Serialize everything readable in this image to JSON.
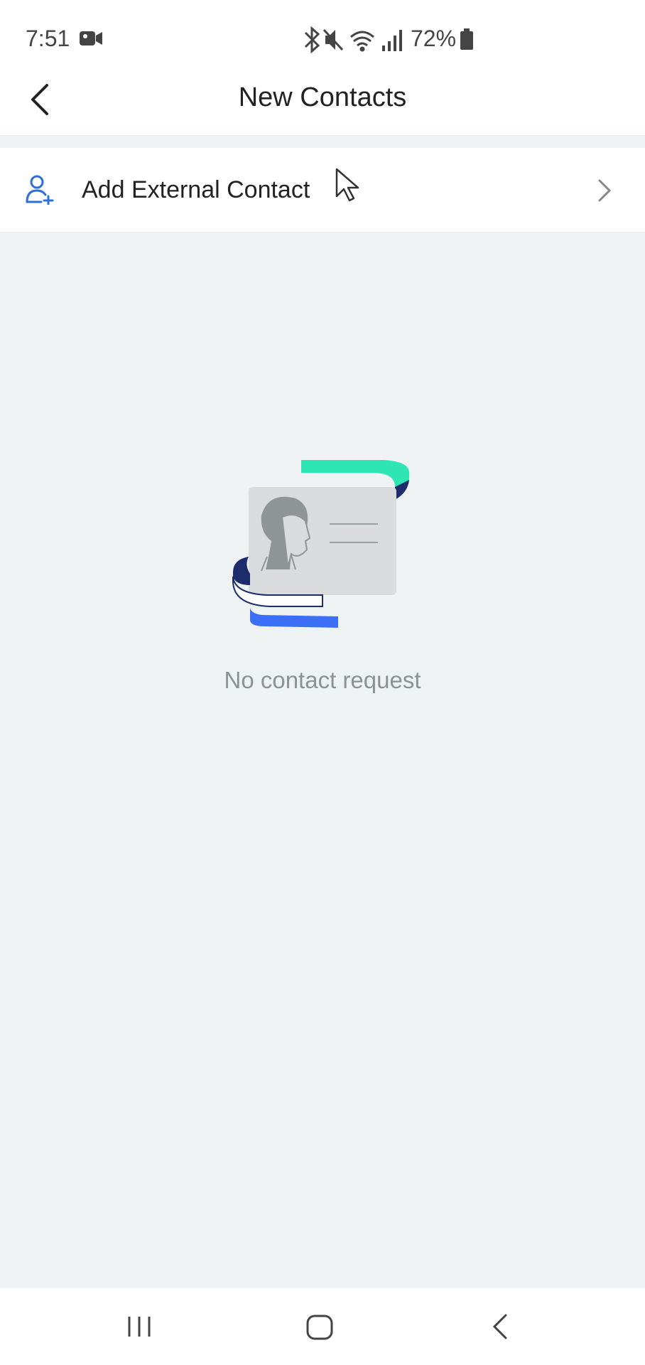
{
  "status_bar": {
    "time": "7:51",
    "battery_percent": "72%",
    "icons": [
      "video-camera-icon",
      "bluetooth-icon",
      "mute-icon",
      "wifi-icon",
      "signal-icon",
      "battery-icon"
    ]
  },
  "header": {
    "title": "New Contacts",
    "back_icon": "chevron-left-icon"
  },
  "add_external": {
    "label": "Add External Contact",
    "icon": "add-person-icon",
    "trailing_icon": "chevron-right-icon"
  },
  "empty_state": {
    "message": "No contact request",
    "illustration": "contact-card-illustration"
  },
  "nav_bar": {
    "buttons": [
      "recents-icon",
      "home-icon",
      "back-icon"
    ]
  },
  "colors": {
    "accent": "#2e6fd8",
    "background": "#eff2f2",
    "teal": "#2ee6b4",
    "navy": "#1d2d6b",
    "blue": "#3b6ff5"
  }
}
